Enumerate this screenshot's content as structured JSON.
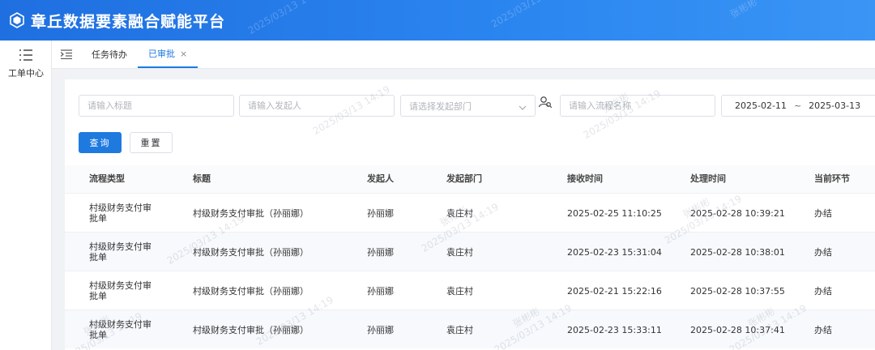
{
  "app": {
    "title": "章丘数据要素融合赋能平台"
  },
  "sidebar": {
    "items": [
      {
        "label": "工单中心",
        "icon": "list-icon"
      }
    ]
  },
  "tabs": [
    {
      "label": "任务待办",
      "active": false
    },
    {
      "label": "已审批",
      "active": true,
      "close": "×"
    }
  ],
  "filters": {
    "title_placeholder": "请输入标题",
    "initiator_placeholder": "请输入发起人",
    "department_placeholder": "请选择发起部门",
    "process_name_placeholder": "请输入流程名称",
    "date_start": "2025-02-11",
    "date_sep": "~",
    "date_end": "2025-03-13"
  },
  "buttons": {
    "query": "查询",
    "reset": "重置"
  },
  "table": {
    "columns": [
      "流程类型",
      "标题",
      "发起人",
      "发起部门",
      "接收时间",
      "处理时间",
      "当前环节"
    ],
    "rows": [
      {
        "type": "村级财务支付审批单",
        "title": "村级财务支付审批（孙丽娜）",
        "initiator": "孙丽娜",
        "department": "袁庄村",
        "received": "2025-02-25 11:10:25",
        "processed": "2025-02-28 10:39:21",
        "stage": "办结"
      },
      {
        "type": "村级财务支付审批单",
        "title": "村级财务支付审批（孙丽娜）",
        "initiator": "孙丽娜",
        "department": "袁庄村",
        "received": "2025-02-23 15:31:04",
        "processed": "2025-02-28 10:38:01",
        "stage": "办结"
      },
      {
        "type": "村级财务支付审批单",
        "title": "村级财务支付审批（孙丽娜）",
        "initiator": "孙丽娜",
        "department": "袁庄村",
        "received": "2025-02-21 15:22:16",
        "processed": "2025-02-28 10:37:55",
        "stage": "办结"
      },
      {
        "type": "村级财务支付审批单",
        "title": "村级财务支付审批（孙丽娜）",
        "initiator": "孙丽娜",
        "department": "袁庄村",
        "received": "2025-02-23 15:33:11",
        "processed": "2025-02-28 10:37:41",
        "stage": "办结"
      }
    ]
  },
  "watermark": {
    "name": "张彬彬",
    "date": "2025/03/13 14:19"
  },
  "colors": {
    "primary": "#1f7ae0",
    "header": "#2b86f0"
  }
}
